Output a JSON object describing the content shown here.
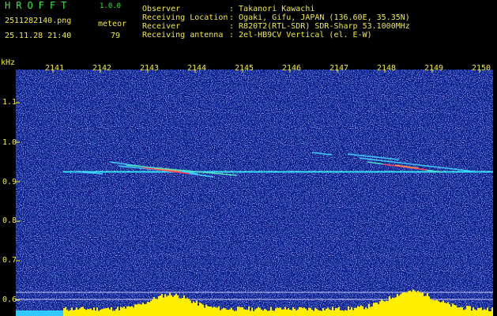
{
  "header": {
    "app_title": "HROFFT",
    "version": "1.0.0",
    "filename": "2511282140.png",
    "datetime": "25.11.28 21:40",
    "meteor_label": "meteor",
    "meteor_count": "79",
    "info": [
      {
        "key": "Observer",
        "value": ": Takanori Kawachi"
      },
      {
        "key": "Receiving Location",
        "value": ": Ogaki, Gifu, JAPAN (136.60E, 35.35N)"
      },
      {
        "key": "Receiver",
        "value": ": R820T2(RTL-SDR) SDR-Sharp 53.1000MHz"
      },
      {
        "key": "Receiving antenna",
        "value": ": 2el-HB9CV Vertical (el. E-W)"
      }
    ]
  },
  "chart_data": {
    "type": "heatmap",
    "ylabel": "kHz",
    "x_ticks": [
      "2141",
      "2142",
      "2143",
      "2144",
      "2145",
      "2146",
      "2147",
      "2148",
      "2149",
      "2150"
    ],
    "y_ticks": [
      "1.1",
      "1.0",
      "0.9",
      "0.8",
      "0.7",
      "0.6"
    ],
    "carrier_khz": 0.925,
    "colors": {
      "background": "#0a1a8a",
      "noise": "#3a6ad8",
      "carrier": "#38e0ff",
      "meteor": "#ff3060",
      "histogram": "#ffee00",
      "text": "#f2ec3a",
      "title": "#33ee33"
    }
  }
}
